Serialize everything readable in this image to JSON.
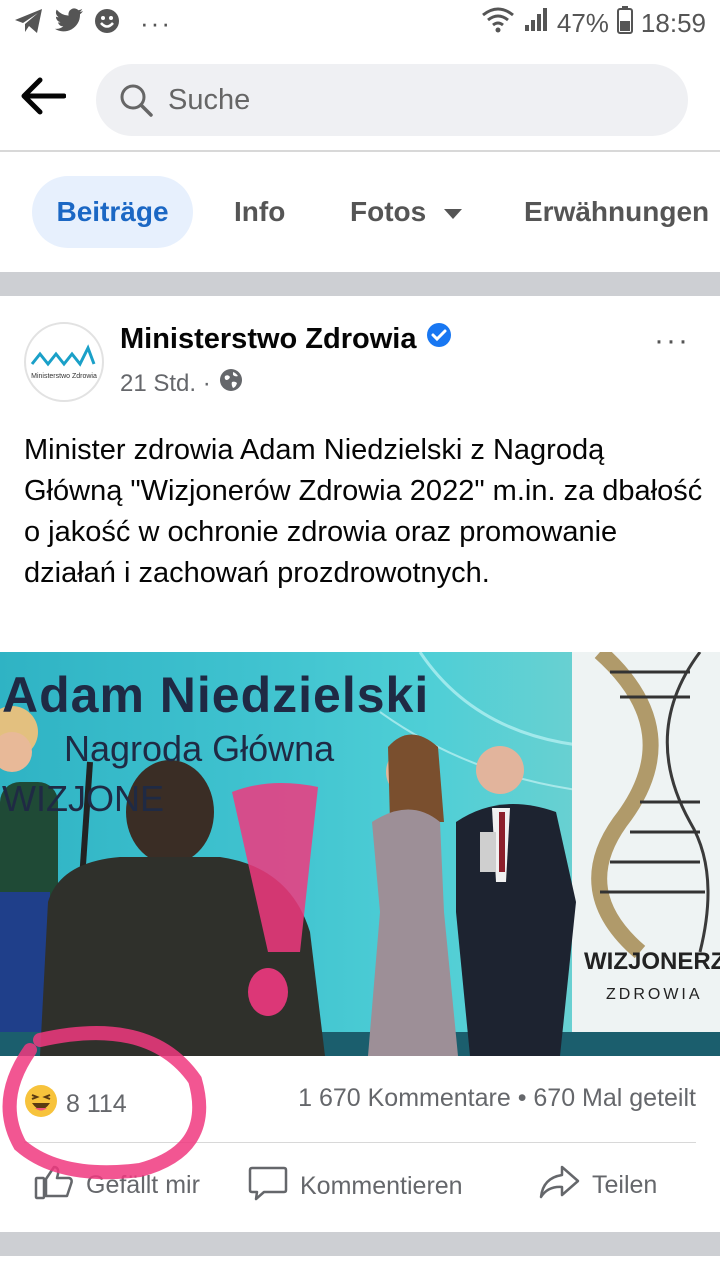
{
  "status_bar": {
    "battery": "47%",
    "time": "18:59",
    "dots": "···"
  },
  "search": {
    "placeholder": "Suche"
  },
  "tabs": [
    {
      "label": "Beiträge",
      "active": true
    },
    {
      "label": "Info",
      "active": false
    },
    {
      "label": "Fotos",
      "active": false
    },
    {
      "label": "Erwähnungen",
      "active": false
    }
  ],
  "post": {
    "author": "Ministerstwo Zdrowia",
    "avatar_text": "Ministerstwo Zdrowia",
    "time": "21 Std. ·",
    "more": "···",
    "text": "Minister zdrowia Adam Niedzielski z Nagrodą Główną \"Wizjonerów Zdrowia 2022\" m.in. za dbałość o jakość w ochronie zdrowia oraz promowanie działań i zachowań prozdrowotnych.",
    "photo": {
      "banner_line1": "Adam Niedzielski",
      "banner_line2": "Nagroda Główna",
      "banner_line3": "WIZJONE",
      "brand_line1": "WIZJONERZY",
      "brand_line2": "ZDROWIA"
    },
    "reaction_count": "8 114",
    "comments_shares": "1 670 Kommentare • 670 Mal geteilt",
    "actions": {
      "like": "Gefällt mir",
      "comment": "Kommentieren",
      "share": "Teilen"
    }
  },
  "colors": {
    "accent": "#1b67c4",
    "tab_active_bg": "#e7f0fd",
    "verified": "#1877f2",
    "annotation": "#f0387f"
  }
}
